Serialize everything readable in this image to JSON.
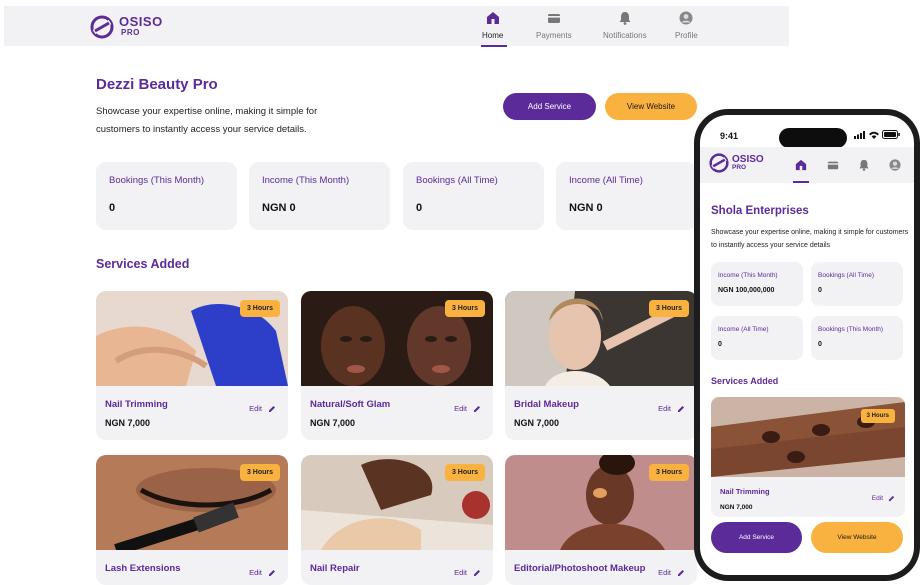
{
  "brand": {
    "name": "OSISO",
    "tier": "PRO",
    "color": "#5b2b9a",
    "accent": "#f9b23f"
  },
  "nav": {
    "items": [
      {
        "label": "Home",
        "icon": "home-icon",
        "active": true
      },
      {
        "label": "Payments",
        "icon": "payments-icon",
        "active": false
      },
      {
        "label": "Notifications",
        "icon": "bell-icon",
        "active": false
      },
      {
        "label": "Profile",
        "icon": "profile-icon",
        "active": false
      }
    ]
  },
  "desktop": {
    "business_name": "Dezzi Beauty Pro",
    "description": "Showcase your expertise online, making it simple for customers to instantly access your service details.",
    "add_service_label": "Add Service",
    "view_website_label": "View Website",
    "stats": [
      {
        "label": "Bookings (This Month)",
        "value": "0"
      },
      {
        "label": "Income (This Month)",
        "value": "NGN 0"
      },
      {
        "label": "Bookings (All Time)",
        "value": "0"
      },
      {
        "label": "Income (All Time)",
        "value": "NGN 0"
      }
    ],
    "services_title": "Services Added",
    "edit_label": "Edit",
    "services": [
      {
        "name": "Nail Trimming",
        "price": "NGN 7,000",
        "duration": "3 Hours"
      },
      {
        "name": "Natural/Soft Glam",
        "price": "NGN 7,000",
        "duration": "3 Hours"
      },
      {
        "name": "Bridal Makeup",
        "price": "NGN 7,000",
        "duration": "3 Hours"
      },
      {
        "name": "Lash Extensions",
        "price": "",
        "duration": "3 Hours"
      },
      {
        "name": "Nail Repair",
        "price": "",
        "duration": "3 Hours"
      },
      {
        "name": "Editorial/Photoshoot Makeup",
        "price": "",
        "duration": "3 Hours"
      }
    ]
  },
  "mobile": {
    "time": "9:41",
    "business_name": "Shola Enterprises",
    "description": "Showcase your expertise online, making it simple for customers to instantly access your service details",
    "stats": [
      {
        "label": "Income (This Month)",
        "value": "NGN 100,000,000"
      },
      {
        "label": "Bookings (All Time)",
        "value": "0"
      },
      {
        "label": "Income (All Time)",
        "value": "0"
      },
      {
        "label": "Bookings (This Month)",
        "value": "0"
      }
    ],
    "services_title": "Services Added",
    "edit_label": "Edit",
    "service": {
      "name": "Nail Trimming",
      "price": "NGN 7,000",
      "duration": "3 Hours"
    },
    "add_service_label": "Add Service",
    "view_website_label": "View Website"
  }
}
